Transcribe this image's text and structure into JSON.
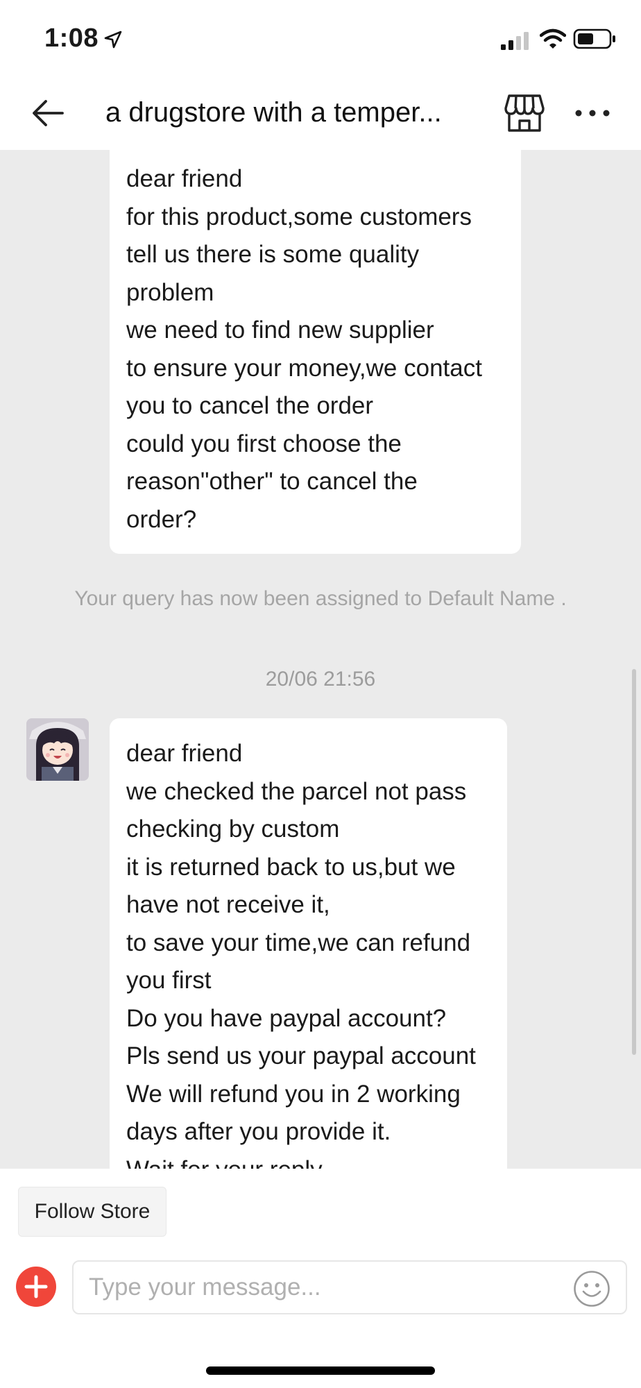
{
  "status_bar": {
    "time": "1:08"
  },
  "header": {
    "title": "a drugstore with a temper..."
  },
  "messages": [
    {
      "lines": [
        "dear friend",
        "for this product,some customers",
        "tell us there is some quality",
        "problem",
        "we need to find new supplier",
        "to ensure your money,we contact",
        "you to cancel the order",
        "could you first choose the",
        "reason\"other\" to cancel the",
        "order?"
      ]
    },
    {
      "lines": [
        "dear friend",
        "we checked the parcel not pass",
        "checking by custom",
        "it is returned back to us,but we",
        "have not receive it,",
        "to save your time,we can refund",
        "you first",
        "Do you have paypal account?",
        "Pls send us your paypal account",
        "We will refund you in 2 working",
        "days after you provide it.",
        "Wait for your reply"
      ]
    }
  ],
  "system_message": "Your query has now been assigned to Default Name .",
  "timestamp": "20/06 21:56",
  "bottom": {
    "follow_label": "Follow Store",
    "input_placeholder": "Type your message..."
  },
  "colors": {
    "chat_background": "#ebebeb",
    "accent_red": "#f0463a",
    "system_text": "#a5a5a5"
  }
}
